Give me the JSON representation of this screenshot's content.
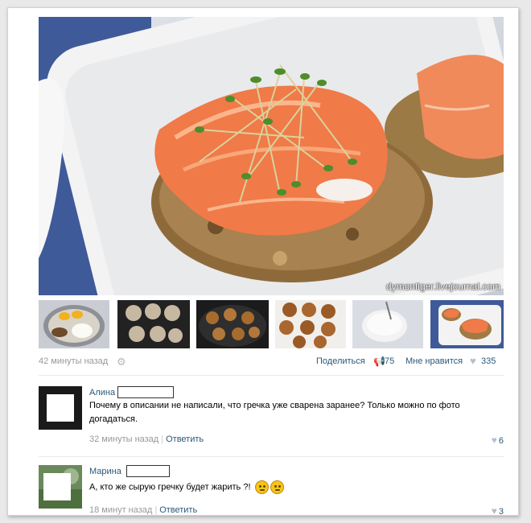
{
  "post": {
    "watermark": "dymontiger.livejournal.com",
    "time": "42 минуты назад",
    "share_label": "Поделиться",
    "share_count": "75",
    "like_label": "Мне нравится",
    "like_count": "335"
  },
  "comments": [
    {
      "author": "Алина",
      "text_line1": "Почему в описании не написали, что гречка уже сварена заранее? Только можно по фото",
      "text_line2": "догадаться.",
      "time": "32 минуты назад",
      "reply": "Ответить",
      "likes": "6"
    },
    {
      "author": "Марина",
      "text": "А, кто же сырую гречку будет жарить ?!",
      "time": "18 минут назад",
      "reply": "Ответить",
      "likes": "3"
    }
  ],
  "icons": {
    "gear": "gear-icon",
    "megaphone": "megaphone-icon",
    "heart": "heart-icon"
  }
}
